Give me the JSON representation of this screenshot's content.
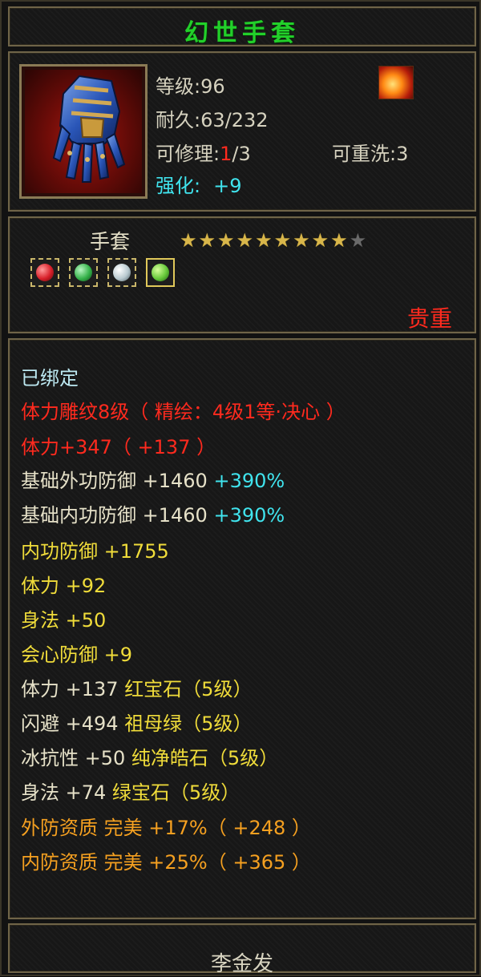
{
  "item": {
    "name": "幻世手套"
  },
  "info": {
    "level_label": "等级",
    "level_value": ":96",
    "durability_label": "耐久",
    "durability_value": ":63/232",
    "repair_label": "可修理:",
    "repair_used": "1",
    "repair_total": "/3",
    "rewash_label": "可重洗",
    "rewash_value": ":3",
    "enhance_label": "强化:",
    "enhance_value": "+9"
  },
  "type": {
    "label": "手套",
    "stars_filled": 9,
    "stars_total": 10,
    "precious": "贵重"
  },
  "gems": [
    {
      "name": "ruby-gem",
      "color": "#d8202a"
    },
    {
      "name": "emerald-gem",
      "color": "#35b24a"
    },
    {
      "name": "diamond-gem",
      "color": "#b8c9cf"
    },
    {
      "name": "green-gem",
      "color": "#66c83a"
    }
  ],
  "attributes": {
    "bound": "已绑定",
    "engraving": "体力雕纹8级（ 精绘：4级1等·决心 ）",
    "stamina_main": "体力+347（ +137 ）",
    "ext_def_base": "基础外功防御  +1460",
    "ext_def_pct": "+390%",
    "int_def_base": "基础内功防御  +1460",
    "int_def_pct": "+390%",
    "int_def": "内功防御  +1755",
    "stamina": "体力  +92",
    "agility": "身法  +50",
    "crit_def": "会心防御  +9",
    "gem1_stat": "体力  +137",
    "gem1_name": "红宝石（5级）",
    "gem2_stat": "闪避  +494",
    "gem2_name": "祖母绿（5级）",
    "gem3_stat": "冰抗性  +50",
    "gem3_name": "纯净皓石（5级）",
    "gem4_stat": "身法  +74",
    "gem4_name": "绿宝石（5级）",
    "ext_quality": "外防资质   完美  +17%（ +248 ）",
    "int_quality": "内防资质   完美  +25%（ +365 ）"
  },
  "colors": {
    "title": "#22d02a",
    "cyan": "#40e4ee",
    "red": "#ff2a1e",
    "yellow": "#f0dc3a",
    "orange": "#f5a020",
    "white": "#e6e1c8"
  },
  "footer": {
    "owner": "李金发"
  }
}
